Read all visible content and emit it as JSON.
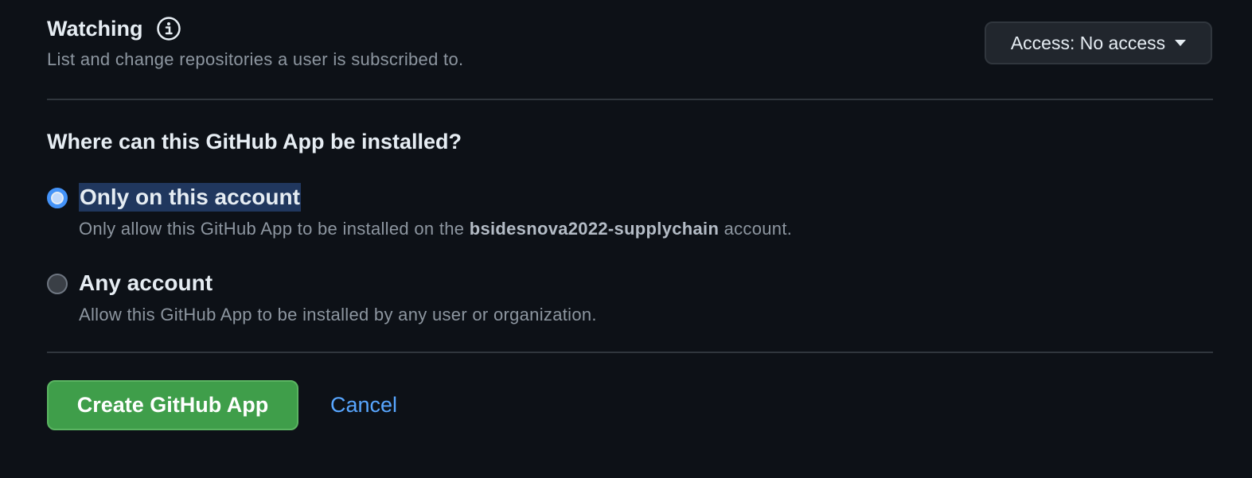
{
  "watching": {
    "title": "Watching",
    "icon": "info-icon",
    "description": "List and change repositories a user is subscribed to.",
    "access_button_label": "Access: No access"
  },
  "install": {
    "heading": "Where can this GitHub App be installed?",
    "options": [
      {
        "label": "Only on this account",
        "selected": true,
        "description_prefix": "Only allow this GitHub App to be installed on the ",
        "description_account": "bsidesnova2022-supplychain",
        "description_suffix": " account."
      },
      {
        "label": "Any account",
        "selected": false,
        "description": "Allow this GitHub App to be installed by any user or organization."
      }
    ]
  },
  "actions": {
    "create_label": "Create GitHub App",
    "cancel_label": "Cancel"
  },
  "colors": {
    "background": "#0d1117",
    "primary_button": "#3f9e4a",
    "link": "#58a6ff",
    "selection_highlight": "#20375e"
  }
}
